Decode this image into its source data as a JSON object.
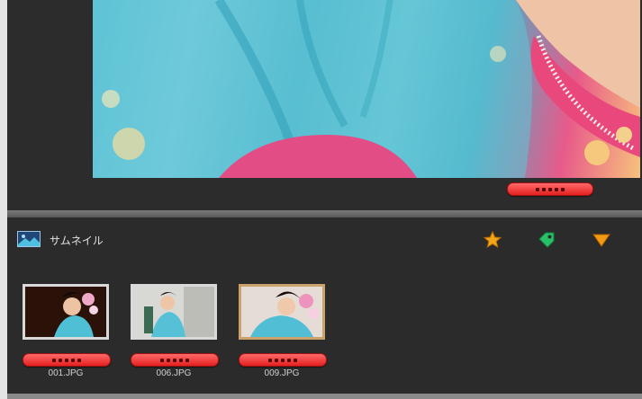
{
  "preview": {
    "rating": 5,
    "rating_color": "#ff3b3b"
  },
  "thumbnails_panel": {
    "title": "サムネイル",
    "icon": "image-icon",
    "tools": [
      {
        "name": "star-icon",
        "color": "#f5a623"
      },
      {
        "name": "tag-icon",
        "color": "#2ecc71"
      },
      {
        "name": "filter-icon",
        "color": "#f39c12"
      }
    ],
    "items": [
      {
        "filename": "001.JPG",
        "rating": 5,
        "selected": false
      },
      {
        "filename": "006.JPG",
        "rating": 5,
        "selected": false
      },
      {
        "filename": "009.JPG",
        "rating": 5,
        "selected": true
      }
    ]
  }
}
